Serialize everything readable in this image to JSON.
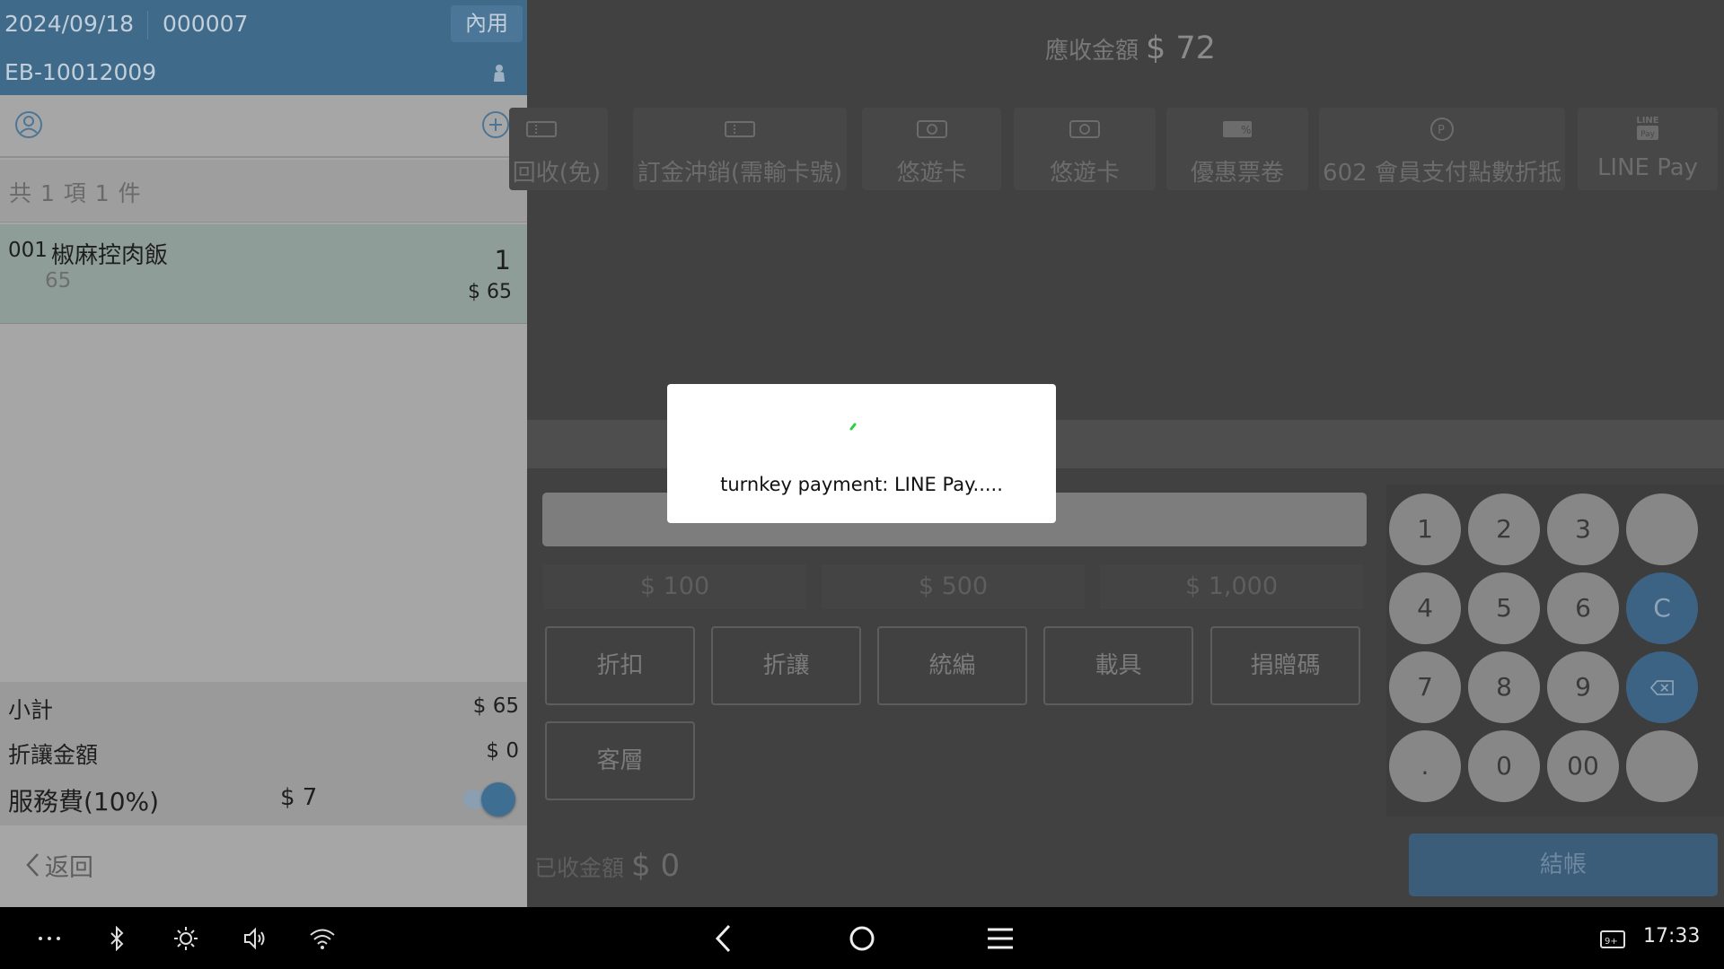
{
  "order_header": {
    "date": "2024/09/18",
    "order_number": "000007",
    "dine_type": "內用",
    "device_id": "EB-10012009"
  },
  "order_summary": "共 1 項 1 件",
  "order_items": [
    {
      "code": "001",
      "name": "椒麻控肉飯",
      "unit_price": "65",
      "quantity": "1",
      "amount": "$ 65"
    }
  ],
  "totals": {
    "subtotal_label": "小計",
    "subtotal_value": "$ 65",
    "discount_label": "折讓金額",
    "discount_value": "$ 0",
    "service_label": "服務費(10%)",
    "service_value": "$ 7",
    "service_enabled": true
  },
  "back_label": "返回",
  "amount_due": {
    "label": "應收金額",
    "value": "$ 72"
  },
  "payment_methods": [
    {
      "label": "回收(免)",
      "icon": "ticket-icon"
    },
    {
      "label": "訂金沖銷(需輸卡號)",
      "icon": "ticket-icon"
    },
    {
      "label": "悠遊卡",
      "icon": "card-icon"
    },
    {
      "label": "悠遊卡",
      "icon": "card-icon"
    },
    {
      "label": "優惠票卷",
      "icon": "coupon-icon"
    },
    {
      "label": "602 會員支付點數折抵",
      "icon": "points-icon"
    },
    {
      "label": "LINE Pay",
      "icon": "line-pay-icon"
    }
  ],
  "line_pay_logo": {
    "top": "LINE",
    "bottom": "Pay"
  },
  "quick_amounts": [
    "$ 100",
    "$ 500",
    "$ 1,000"
  ],
  "action_buttons": [
    "折扣",
    "折讓",
    "統編",
    "載具",
    "捐贈碼",
    "客層"
  ],
  "keypad": {
    "row1": [
      "1",
      "2",
      "3",
      ""
    ],
    "row2": [
      "4",
      "5",
      "6",
      "C"
    ],
    "row3": [
      "7",
      "8",
      "9",
      "backspace"
    ],
    "row4": [
      ".",
      "0",
      "00",
      ""
    ]
  },
  "amount_received": {
    "label": "已收金額",
    "value": "$ 0"
  },
  "checkout_label": "結帳",
  "modal": {
    "message": "turnkey payment: LINE Pay....."
  },
  "status_bar": {
    "time": "17:33"
  },
  "colors": {
    "header_blue": "#3f6a8a",
    "accent_blue": "#3d6384",
    "spinner_green": "#2ecc40"
  }
}
